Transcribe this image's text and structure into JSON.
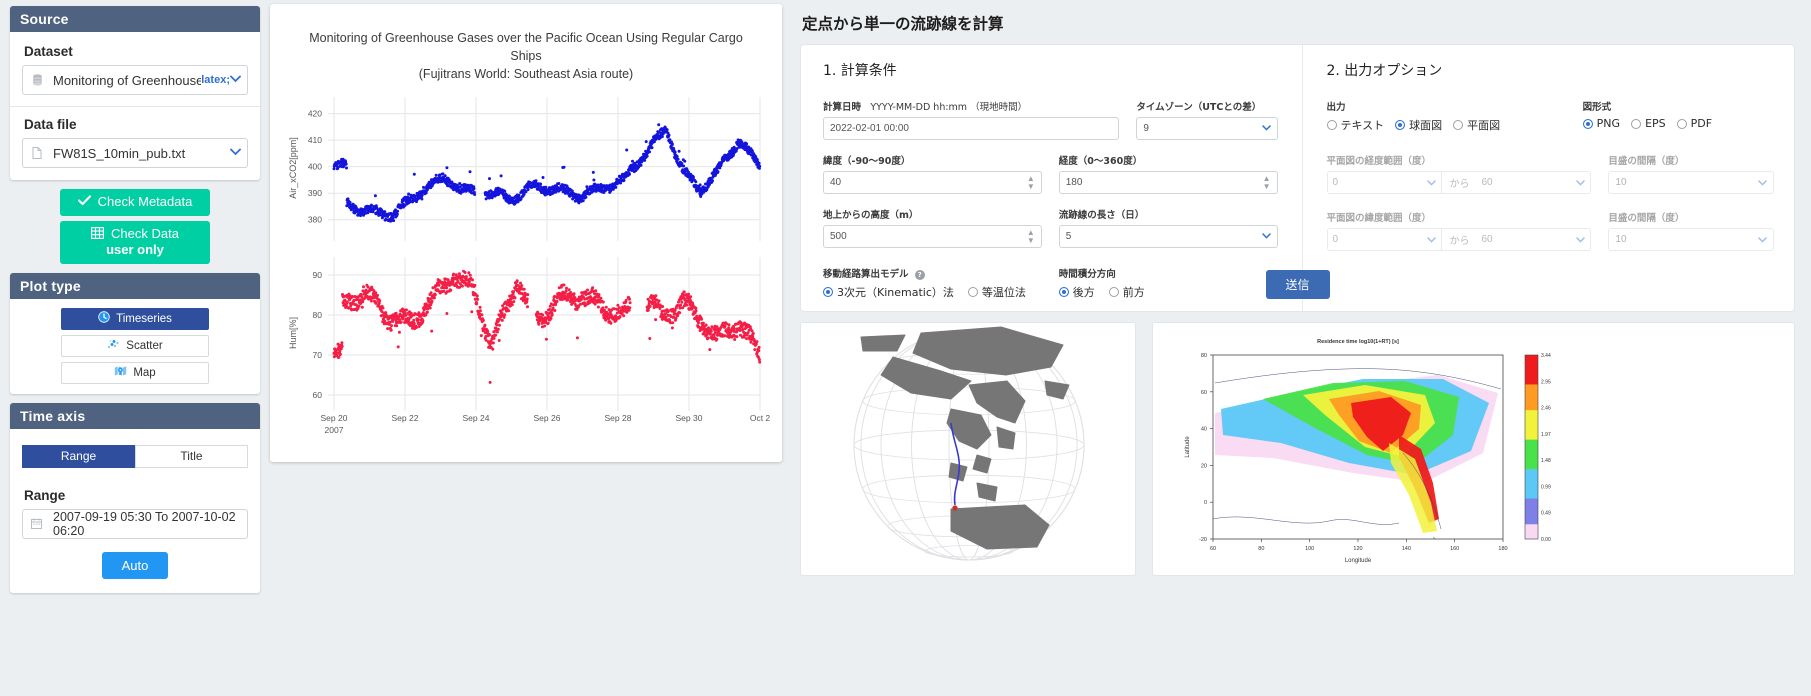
{
  "sidebar": {
    "source": {
      "title": "Source",
      "dataset_label": "Dataset",
      "dataset_value": "Monitoring of Greenhouse Gases",
      "datafile_label": "Data file",
      "datafile_value": "FW81S_10min_pub.txt"
    },
    "buttons": {
      "check_metadata": "Check Metadata",
      "check_data": "Check Data",
      "check_data_sub": "user only"
    },
    "plot_type": {
      "title": "Plot type",
      "options": [
        {
          "label": "Timeseries",
          "icon": "clock-icon",
          "active": true
        },
        {
          "label": "Scatter",
          "icon": "scatter-icon",
          "active": false
        },
        {
          "label": "Map",
          "icon": "map-icon",
          "active": false
        }
      ]
    },
    "time_axis": {
      "title": "Time axis",
      "tabs": [
        {
          "label": "Range",
          "active": true
        },
        {
          "label": "Title",
          "active": false
        }
      ],
      "range_label": "Range",
      "range_value": "2007-09-19 05:30 To 2007-10-02 06:20",
      "auto_button": "Auto"
    }
  },
  "chart_data": {
    "type": "scatter",
    "title": "Monitoring of Greenhouse Gases over the Pacific Ocean Using Regular Cargo Ships",
    "subtitle": "(Fujitrans World: Southeast Asia route)",
    "xlabel": "",
    "x_tick_labels": [
      "Sep 20",
      "Sep 22",
      "Sep 24",
      "Sep 26",
      "Sep 28",
      "Sep 30",
      "Oct 2"
    ],
    "x_year_label": "2007",
    "panels": [
      {
        "name": "Air_xCO2",
        "ylabel": "Air_xCO2[ppm]",
        "color": "#1414dc",
        "ylim": [
          375,
          424
        ],
        "yticks": [
          380,
          390,
          400,
          410,
          420
        ]
      },
      {
        "name": "Hum",
        "ylabel": "Hum[%]",
        "color": "#f41e46",
        "ylim": [
          58,
          93
        ],
        "yticks": [
          60,
          70,
          80,
          90
        ]
      }
    ]
  },
  "right": {
    "heading": "定点から単一の流跡線を計算",
    "section1": {
      "title": "1. 計算条件",
      "datetime_label_bold": "計算日時",
      "datetime_label_thin": "YYYY-MM-DD hh:mm （現地時間）",
      "datetime_value": "2022-02-01 00:00",
      "timezone_label": "タイムゾーン（UTCとの差）",
      "timezone_value": "9",
      "lat_label": "緯度（-90〜90度）",
      "lat_value": "40",
      "lon_label": "経度（0〜360度）",
      "lon_value": "180",
      "height_label": "地上からの高度（m）",
      "height_value": "500",
      "duration_label": "流跡線の長さ（日）",
      "duration_value": "5",
      "model_label": "移動経路算出モデル",
      "model_options": [
        {
          "label": "3次元（Kinematic）法",
          "selected": true
        },
        {
          "label": "等温位法",
          "selected": false
        }
      ],
      "direction_label": "時間積分方向",
      "direction_options": [
        {
          "label": "後方",
          "selected": true
        },
        {
          "label": "前方",
          "selected": false
        }
      ]
    },
    "section2": {
      "title": "2. 出力オプション",
      "output_label": "出力",
      "output_options": [
        {
          "label": "テキスト",
          "selected": false
        },
        {
          "label": "球面図",
          "selected": true
        },
        {
          "label": "平面図",
          "selected": false
        }
      ],
      "format_label": "図形式",
      "format_options": [
        {
          "label": "PNG",
          "selected": true
        },
        {
          "label": "EPS",
          "selected": false
        },
        {
          "label": "PDF",
          "selected": false
        }
      ],
      "rows": [
        {
          "range_label": "平面図の経度範囲（度）",
          "from_value": "0",
          "between_label": "から",
          "to_value": "60",
          "tick_label": "目盛の間隔（度）",
          "tick_value": "10"
        },
        {
          "range_label": "平面図の緯度範囲（度）",
          "from_value": "0",
          "between_label": "から",
          "to_value": "60",
          "tick_label": "目盛の間隔（度）",
          "tick_value": "10"
        }
      ]
    },
    "submit_button": "送信"
  },
  "heatmap": {
    "type": "heatmap",
    "title": "Residence time log10(1+RT) [s]",
    "xlabel": "Longitude",
    "ylabel": "Latitude",
    "xticks": [
      "60",
      "80",
      "100",
      "120",
      "140",
      "160",
      "180"
    ],
    "yticks": [
      "80",
      "60",
      "40",
      "20",
      "0",
      "-20"
    ],
    "colorbar_ticks": [
      "3.44",
      "2.95",
      "2.46",
      "1.97",
      "1.48",
      "0.99",
      "0.49",
      "0.00"
    ]
  }
}
